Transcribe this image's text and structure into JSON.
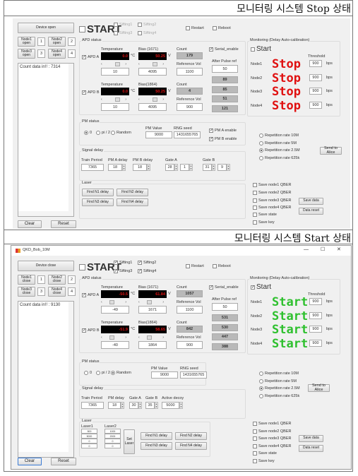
{
  "captions": {
    "stop": "모니터링 시스템 Stop 상태",
    "start": "모니터링 시스템 Start 상태"
  },
  "stop_panel": {
    "device_button": "Device open",
    "node_buttons": [
      {
        "label": "Node1\nopen",
        "value": "1"
      },
      {
        "label": "Node2\nopen",
        "value": "2"
      },
      {
        "label": "Node3\nopen",
        "value": "3"
      },
      {
        "label": "Node4\nopen",
        "value": "4"
      }
    ],
    "log_text": "Count data in!! : 7314",
    "clear": "Clear",
    "reset": "Reset",
    "start": {
      "label": "START",
      "checked": false
    },
    "sifting": [
      {
        "label": "Sifting1",
        "checked": false
      },
      {
        "label": "Sifting2",
        "checked": false
      },
      {
        "label": "Sifting3",
        "checked": false
      },
      {
        "label": "Sifting4",
        "checked": false
      }
    ],
    "restart": {
      "label": "Restart",
      "checked": false
    },
    "reboot": {
      "label": "Reboot",
      "checked": false
    },
    "apd_status": {
      "title": "APD status",
      "apds": [
        {
          "label": "APD A",
          "checked": true,
          "temperature_label": "Temperature",
          "temperature": "0.0",
          "temp_unit": "°C",
          "bias_label": "Bias (1671)",
          "bias": "50.25",
          "bias_unit": "V",
          "temperature_set": "10",
          "bias_set": "4095",
          "count_label": "Count",
          "count": "179",
          "ref_label": "Reference Vol",
          "ref": "1100"
        },
        {
          "label": "APD B",
          "checked": true,
          "temperature_label": "Temperature",
          "temperature": "0.0",
          "temp_unit": "°C",
          "bias_label": "Bias(1864)",
          "bias": "50.25",
          "bias_unit": "V",
          "temperature_set": "10",
          "bias_set": "4095",
          "count_label": "Count",
          "count": "4",
          "ref_label": "Reference Vol",
          "ref": "900"
        }
      ],
      "serial_enable": {
        "label": "Serial_enable",
        "checked": true
      },
      "after_pulse_label": "After Pulse ref",
      "after_pulse_ref": "50",
      "after_pulse_values": [
        "89",
        "85",
        "51",
        "121"
      ]
    },
    "monitoring": {
      "title": "Monitoring (Delay Auto-calibration)",
      "start": {
        "label": "Start",
        "checked": false
      },
      "threshold_label": "Threshold",
      "status_color": "#e01010",
      "nodes": [
        {
          "label": "Node1",
          "status": "Stop",
          "threshold": "900",
          "unit": "bps"
        },
        {
          "label": "Node2",
          "status": "Stop",
          "threshold": "900",
          "unit": "bps"
        },
        {
          "label": "Node3",
          "status": "Stop",
          "threshold": "900",
          "unit": "bps"
        },
        {
          "label": "Node4",
          "status": "Stop",
          "threshold": "900",
          "unit": "bps"
        }
      ]
    },
    "pm_status": {
      "title": "PM status",
      "options": [
        {
          "label": "0",
          "selected": true
        },
        {
          "label": "pi / 2",
          "selected": false
        },
        {
          "label": "Random",
          "selected": false
        }
      ],
      "pm_value_label": "PM Value",
      "pm_value": "9000",
      "rng_seed_label": "RNG seed",
      "rng_seed": "1431655765",
      "pm_a_enable": {
        "label": "PM A enable",
        "checked": true
      },
      "pm_b_enable": {
        "label": "PM B enable",
        "checked": true
      }
    },
    "repetition_rates": [
      {
        "label": "Repetition rate 10M",
        "selected": false
      },
      {
        "label": "Repetition rate 5M",
        "selected": false
      },
      {
        "label": "Repetition rate 2.5M",
        "selected": true
      },
      {
        "label": "Repetition rate 625k",
        "selected": false
      }
    ],
    "send_to_alice": "Send to Alice",
    "signal_delay": {
      "title": "Signal delay",
      "fields": [
        {
          "label": "Train Period",
          "values": [
            "7365"
          ]
        },
        {
          "label": "PM A delay",
          "values": [
            "18"
          ]
        },
        {
          "label": "PM B delay",
          "values": [
            "18"
          ]
        },
        {
          "label": "Gate A",
          "values": [
            "28",
            "1"
          ]
        },
        {
          "label": "Gate B",
          "values": [
            "31",
            "9"
          ]
        }
      ]
    },
    "laser": {
      "title": "Laser",
      "buttons": [
        "Find N1 delay",
        "Find N2 delay",
        "Find N3 delay",
        "Find N4 delay"
      ]
    },
    "save_options": [
      {
        "label": "Save node1 QBER",
        "checked": false
      },
      {
        "label": "Save node2 QBER",
        "checked": false
      },
      {
        "label": "Save node3 QBER",
        "checked": false
      },
      {
        "label": "Save node4 QBER",
        "checked": false
      },
      {
        "label": "Save state",
        "checked": false
      },
      {
        "label": "Save key",
        "checked": false
      }
    ],
    "save_data": "Save data",
    "data_reset": "Data reset"
  },
  "start_panel": {
    "window_title": "QKD_Bob_10M",
    "window_controls": {
      "minimize": "—",
      "maximize": "☐",
      "close": "✕"
    },
    "device_button": "Device close",
    "node_buttons": [
      {
        "label": "Node1\nclose",
        "value": "1"
      },
      {
        "label": "Node2\nclose",
        "value": "2"
      },
      {
        "label": "Node3\nclose",
        "value": "3"
      },
      {
        "label": "Node4\nclose",
        "value": "4"
      }
    ],
    "log_text": "Count data in!! : 9130",
    "clear": "Clear",
    "reset": "Reset",
    "start": {
      "label": "START",
      "checked": false
    },
    "sifting": [
      {
        "label": "Sifting1",
        "checked": true
      },
      {
        "label": "Sifting2",
        "checked": true
      },
      {
        "label": "Sifting3",
        "checked": true
      },
      {
        "label": "Sifting4",
        "checked": true
      }
    ],
    "restart": {
      "label": "Restart",
      "checked": false
    },
    "reboot": {
      "label": "Reboot",
      "checked": false
    },
    "apd_status": {
      "title": "APD status",
      "apds": [
        {
          "label": "APD A",
          "checked": true,
          "temperature_label": "Temperature",
          "temperature": "-50.5",
          "temp_unit": "°C",
          "bias_label": "Bias (1671)",
          "bias": "61.84",
          "bias_unit": "V",
          "temperature_set": "-49",
          "bias_set": "1671",
          "count_label": "Count",
          "count": "1057",
          "ref_label": "Reference Vol",
          "ref": "1100"
        },
        {
          "label": "APD B",
          "checked": true,
          "temperature_label": "Temperature",
          "temperature": "-51.9",
          "temp_unit": "°C",
          "bias_label": "Bias(1864)",
          "bias": "58.65",
          "bias_unit": "V",
          "temperature_set": "-40",
          "bias_set": "1864",
          "count_label": "Count",
          "count": "842",
          "ref_label": "Reference Vol",
          "ref": "900"
        }
      ],
      "serial_enable": {
        "label": "Serial_enable",
        "checked": true
      },
      "after_pulse_label": "After Pulse ref",
      "after_pulse_ref": "50",
      "after_pulse_values": [
        "531",
        "530",
        "447",
        "388"
      ]
    },
    "monitoring": {
      "title": "Monitoring (Delay Auto-calibration)",
      "start": {
        "label": "Start",
        "checked": true
      },
      "threshold_label": "Threshold",
      "status_color": "#2ec02e",
      "nodes": [
        {
          "label": "Node1",
          "status": "Start",
          "threshold": "900",
          "unit": "bps"
        },
        {
          "label": "Node2",
          "status": "Start",
          "threshold": "900",
          "unit": "bps"
        },
        {
          "label": "Node3",
          "status": "Start",
          "threshold": "900",
          "unit": "bps"
        },
        {
          "label": "Node4",
          "status": "Start",
          "threshold": "900",
          "unit": "bps"
        }
      ]
    },
    "pm_status": {
      "title": "PM status",
      "options": [
        {
          "label": "0",
          "selected": false
        },
        {
          "label": "pi / 2",
          "selected": false
        },
        {
          "label": "Random",
          "selected": true
        }
      ],
      "pm_value_label": "PM Value",
      "pm_value": "9000",
      "rng_seed_label": "RNG seed",
      "rng_seed": "1431655765"
    },
    "repetition_rates": [
      {
        "label": "Repetition rate 10M",
        "selected": false
      },
      {
        "label": "Repetition rate 5M",
        "selected": false
      },
      {
        "label": "Repetition rate 2.5M",
        "selected": true
      },
      {
        "label": "Repetition rate 625k",
        "selected": false
      }
    ],
    "send_to_alice": "Send to Alice",
    "signal_delay": {
      "title": "Signal delay",
      "fields": [
        {
          "label": "Train Period",
          "values": [
            "7365"
          ]
        },
        {
          "label": "PM delay",
          "values": [
            "18"
          ]
        },
        {
          "label": "Gate A",
          "values": [
            "30"
          ]
        },
        {
          "label": "Gate B",
          "values": [
            "35"
          ]
        },
        {
          "label": "Active decoy",
          "values": [
            "5000"
          ]
        }
      ]
    },
    "laser": {
      "title": "Laser",
      "laser1_label": "Laser1",
      "laser1_values": [
        "500",
        "5000",
        "0",
        "0"
      ],
      "laser2_label": "Laser2",
      "laser2_values": [
        "1000",
        "2000",
        "0",
        "0"
      ],
      "set_laser": "Set\nLaser",
      "buttons": [
        "Find N1 delay",
        "Find N2 delay",
        "Find N3 delay",
        "Find N4 delay"
      ]
    },
    "save_options": [
      {
        "label": "Save node1 QBER",
        "checked": false
      },
      {
        "label": "Save node2 QBER",
        "checked": false
      },
      {
        "label": "Save node3 QBER",
        "checked": false
      },
      {
        "label": "Save node4 QBER",
        "checked": false
      },
      {
        "label": "Save state",
        "checked": false
      },
      {
        "label": "Save key",
        "checked": false
      }
    ],
    "save_data": "Save data",
    "data_reset": "Data reset"
  }
}
